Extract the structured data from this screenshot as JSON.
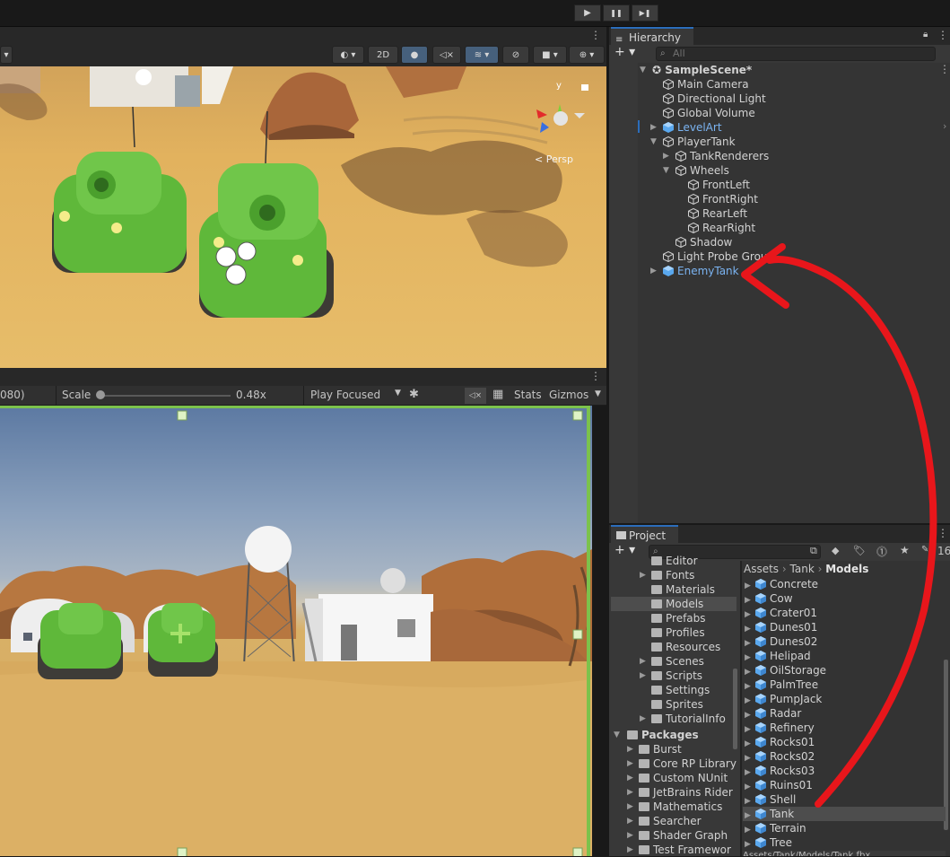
{
  "toolbar": {
    "play_icon": "play-icon",
    "pause_icon": "pause-icon",
    "step_icon": "step-icon",
    "play_glyph": "▶",
    "pause_glyph": "❚❚",
    "step_glyph": "▶❚"
  },
  "scene": {
    "mode_2d": "2D",
    "persp_label": "< Persp",
    "gizmo_y": "y"
  },
  "game": {
    "resolution": "080)",
    "scale_label": "Scale",
    "scale_value": "0.48x",
    "play_mode": "Play Focused",
    "stats": "Stats",
    "gizmos": "Gizmos"
  },
  "hierarchy": {
    "tab": "Hierarchy",
    "search_placeholder": "All",
    "scene": "SampleScene*",
    "items": [
      {
        "label": "Main Camera",
        "prefab": false
      },
      {
        "label": "Directional Light",
        "prefab": false
      },
      {
        "label": "Global Volume",
        "prefab": false
      },
      {
        "label": "LevelArt",
        "prefab": true
      },
      {
        "label": "PlayerTank",
        "prefab": false
      },
      {
        "label": "TankRenderers",
        "prefab": false
      },
      {
        "label": "Wheels",
        "prefab": false
      },
      {
        "label": "FrontLeft",
        "prefab": false
      },
      {
        "label": "FrontRight",
        "prefab": false
      },
      {
        "label": "RearLeft",
        "prefab": false
      },
      {
        "label": "RearRight",
        "prefab": false
      },
      {
        "label": "Shadow",
        "prefab": false
      },
      {
        "label": "Light Probe Grou",
        "prefab": false
      },
      {
        "label": "EnemyTank",
        "prefab": true
      }
    ]
  },
  "project": {
    "tab": "Project",
    "count": "16",
    "breadcrumb": [
      "Assets",
      "Tank",
      "Models"
    ],
    "folders": [
      "Editor",
      "Fonts",
      "Materials",
      "Models",
      "Prefabs",
      "Profiles",
      "Resources",
      "Scenes",
      "Scripts",
      "Settings",
      "Sprites",
      "TutorialInfo"
    ],
    "packages_label": "Packages",
    "packages": [
      "Burst",
      "Core RP Library",
      "Custom NUnit",
      "JetBrains Rider",
      "Mathematics",
      "Searcher",
      "Shader Graph",
      "Test Framewor"
    ],
    "models": [
      "Concrete",
      "Cow",
      "Crater01",
      "Dunes01",
      "Dunes02",
      "Helipad",
      "OilStorage",
      "PalmTree",
      "PumpJack",
      "Radar",
      "Refinery",
      "Rocks01",
      "Rocks02",
      "Rocks03",
      "Ruins01",
      "Shell",
      "Tank",
      "Terrain",
      "Tree"
    ],
    "selected_model": "Tank",
    "footer_path": "Assets/Tank/Models/Tank.fbx"
  },
  "colors": {
    "accent_blue": "#2b6dbb",
    "prefab_blue": "#7bb4f2",
    "annotation_red": "#e8161b",
    "tank_green": "#6cc24a"
  }
}
